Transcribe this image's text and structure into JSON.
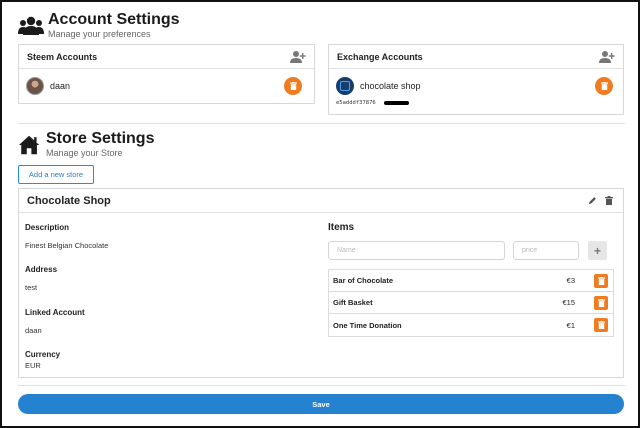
{
  "account_settings": {
    "title": "Account Settings",
    "subtitle": "Manage your preferences",
    "steem_accounts": {
      "title": "Steem Accounts",
      "items": [
        {
          "name": "daan"
        }
      ]
    },
    "exchange_accounts": {
      "title": "Exchange Accounts",
      "items": [
        {
          "name": "chocolate shop",
          "key": "e5adddf37876"
        }
      ]
    }
  },
  "store_settings": {
    "title": "Store Settings",
    "subtitle": "Manage your Store",
    "add_store_label": "Add a new store"
  },
  "store": {
    "name": "Chocolate Shop",
    "description_label": "Description",
    "description": "Finest Belgian Chocolate",
    "address_label": "Address",
    "address": "test",
    "linked_account_label": "Linked Account",
    "linked_account": "daan",
    "currency_label": "Currency",
    "currency": "EUR",
    "items_title": "Items",
    "name_placeholder": "Name",
    "price_placeholder": "price",
    "add_item_label": "+",
    "items": [
      {
        "name": "Bar of Chocolate",
        "price": "€3"
      },
      {
        "name": "Gift Basket",
        "price": "€15"
      },
      {
        "name": "One Time Donation",
        "price": "€1"
      }
    ]
  },
  "save_label": "Save",
  "colors": {
    "accent_blue": "#2582d1",
    "delete_orange": "#f07c22",
    "text_dark": "#222222"
  },
  "icons": {
    "account_settings": "users-icon",
    "store_settings": "home-icon",
    "add_account": "user-plus-icon",
    "delete": "trash-icon",
    "edit": "pencil-icon"
  }
}
